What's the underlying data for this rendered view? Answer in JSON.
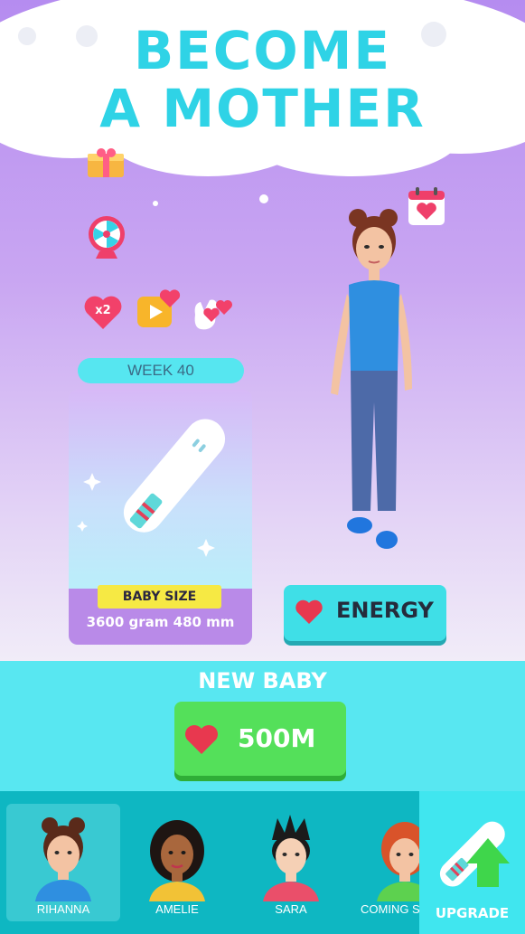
{
  "header": {
    "title_line1": "BECOME",
    "title_line2": "A MOTHER"
  },
  "bonus_icons": {
    "x2_label": "x2"
  },
  "week": {
    "label": "WEEK 40"
  },
  "baby_card": {
    "size_label": "BABY SIZE",
    "measurements": "3600 gram  480 mm"
  },
  "energy_button": {
    "label": "ENERGY"
  },
  "new_baby": {
    "title": "NEW BABY",
    "price": "500M"
  },
  "characters": [
    {
      "name": "RIHANNA",
      "selected": true
    },
    {
      "name": "AMELIE",
      "selected": false
    },
    {
      "name": "SARA",
      "selected": false
    },
    {
      "name": "COMING S",
      "selected": false
    }
  ],
  "upgrade": {
    "label": "UPGRADE"
  },
  "colors": {
    "accent_cyan": "#2fd3e6",
    "heart_red": "#e8384f",
    "buy_green": "#54e05a",
    "bar_teal": "#0eb7c2"
  }
}
